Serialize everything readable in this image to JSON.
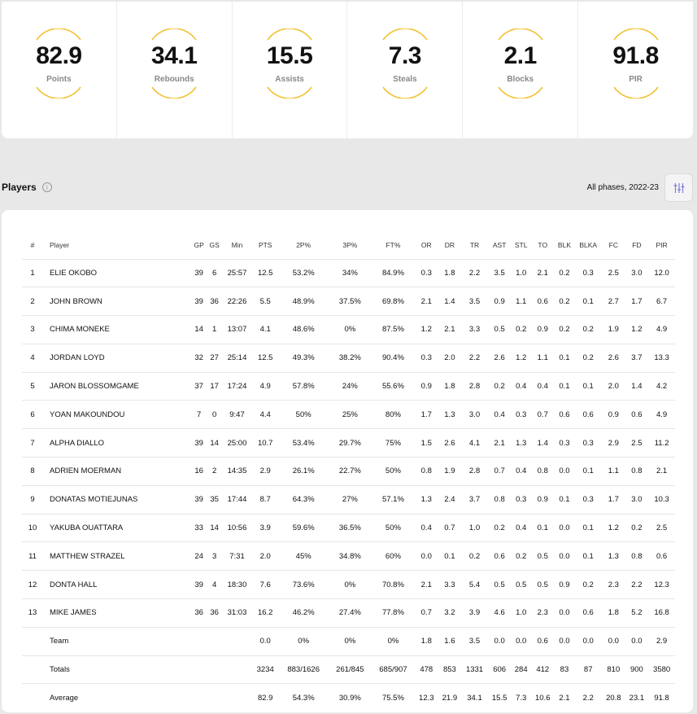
{
  "stats": [
    {
      "value": "82.9",
      "label": "Points"
    },
    {
      "value": "34.1",
      "label": "Rebounds"
    },
    {
      "value": "15.5",
      "label": "Assists"
    },
    {
      "value": "7.3",
      "label": "Steals"
    },
    {
      "value": "2.1",
      "label": "Blocks"
    },
    {
      "value": "91.8",
      "label": "PIR"
    }
  ],
  "players_section": {
    "title": "Players",
    "info_icon": "info-icon",
    "phase_filter": "All phases, 2022-23",
    "filter_icon": "sliders-icon"
  },
  "accent_color": "#f2c230",
  "table": {
    "headers": [
      "#",
      "Player",
      "GP",
      "GS",
      "Min",
      "PTS",
      "2P%",
      "3P%",
      "FT%",
      "OR",
      "DR",
      "TR",
      "AST",
      "STL",
      "TO",
      "BLK",
      "BLKA",
      "FC",
      "FD",
      "PIR"
    ],
    "rows": [
      [
        "1",
        "ELIE OKOBO",
        "39",
        "6",
        "25:57",
        "12.5",
        "53.2%",
        "34%",
        "84.9%",
        "0.3",
        "1.8",
        "2.2",
        "3.5",
        "1.0",
        "2.1",
        "0.2",
        "0.3",
        "2.5",
        "3.0",
        "12.0"
      ],
      [
        "2",
        "JOHN BROWN",
        "39",
        "36",
        "22:26",
        "5.5",
        "48.9%",
        "37.5%",
        "69.8%",
        "2.1",
        "1.4",
        "3.5",
        "0.9",
        "1.1",
        "0.6",
        "0.2",
        "0.1",
        "2.7",
        "1.7",
        "6.7"
      ],
      [
        "3",
        "CHIMA MONEKE",
        "14",
        "1",
        "13:07",
        "4.1",
        "48.6%",
        "0%",
        "87.5%",
        "1.2",
        "2.1",
        "3.3",
        "0.5",
        "0.2",
        "0.9",
        "0.2",
        "0.2",
        "1.9",
        "1.2",
        "4.9"
      ],
      [
        "4",
        "JORDAN LOYD",
        "32",
        "27",
        "25:14",
        "12.5",
        "49.3%",
        "38.2%",
        "90.4%",
        "0.3",
        "2.0",
        "2.2",
        "2.6",
        "1.2",
        "1.1",
        "0.1",
        "0.2",
        "2.6",
        "3.7",
        "13.3"
      ],
      [
        "5",
        "JARON BLOSSOMGAME",
        "37",
        "17",
        "17:24",
        "4.9",
        "57.8%",
        "24%",
        "55.6%",
        "0.9",
        "1.8",
        "2.8",
        "0.2",
        "0.4",
        "0.4",
        "0.1",
        "0.1",
        "2.0",
        "1.4",
        "4.2"
      ],
      [
        "6",
        "YOAN MAKOUNDOU",
        "7",
        "0",
        "9:47",
        "4.4",
        "50%",
        "25%",
        "80%",
        "1.7",
        "1.3",
        "3.0",
        "0.4",
        "0.3",
        "0.7",
        "0.6",
        "0.6",
        "0.9",
        "0.6",
        "4.9"
      ],
      [
        "7",
        "ALPHA DIALLO",
        "39",
        "14",
        "25:00",
        "10.7",
        "53.4%",
        "29.7%",
        "75%",
        "1.5",
        "2.6",
        "4.1",
        "2.1",
        "1.3",
        "1.4",
        "0.3",
        "0.3",
        "2.9",
        "2.5",
        "11.2"
      ],
      [
        "8",
        "ADRIEN MOERMAN",
        "16",
        "2",
        "14:35",
        "2.9",
        "26.1%",
        "22.7%",
        "50%",
        "0.8",
        "1.9",
        "2.8",
        "0.7",
        "0.4",
        "0.8",
        "0.0",
        "0.1",
        "1.1",
        "0.8",
        "2.1"
      ],
      [
        "9",
        "DONATAS MOTIEJUNAS",
        "39",
        "35",
        "17:44",
        "8.7",
        "64.3%",
        "27%",
        "57.1%",
        "1.3",
        "2.4",
        "3.7",
        "0.8",
        "0.3",
        "0.9",
        "0.1",
        "0.3",
        "1.7",
        "3.0",
        "10.3"
      ],
      [
        "10",
        "YAKUBA OUATTARA",
        "33",
        "14",
        "10:56",
        "3.9",
        "59.6%",
        "36.5%",
        "50%",
        "0.4",
        "0.7",
        "1.0",
        "0.2",
        "0.4",
        "0.1",
        "0.0",
        "0.1",
        "1.2",
        "0.2",
        "2.5"
      ],
      [
        "11",
        "MATTHEW STRAZEL",
        "24",
        "3",
        "7:31",
        "2.0",
        "45%",
        "34.8%",
        "60%",
        "0.0",
        "0.1",
        "0.2",
        "0.6",
        "0.2",
        "0.5",
        "0.0",
        "0.1",
        "1.3",
        "0.8",
        "0.6"
      ],
      [
        "12",
        "DONTA HALL",
        "39",
        "4",
        "18:30",
        "7.6",
        "73.6%",
        "0%",
        "70.8%",
        "2.1",
        "3.3",
        "5.4",
        "0.5",
        "0.5",
        "0.5",
        "0.9",
        "0.2",
        "2.3",
        "2.2",
        "12.3"
      ],
      [
        "13",
        "MIKE JAMES",
        "36",
        "36",
        "31:03",
        "16.2",
        "46.2%",
        "27.4%",
        "77.8%",
        "0.7",
        "3.2",
        "3.9",
        "4.6",
        "1.0",
        "2.3",
        "0.0",
        "0.6",
        "1.8",
        "5.2",
        "16.8"
      ]
    ],
    "summary_rows": [
      [
        "",
        "Team",
        "",
        "",
        "",
        "0.0",
        "0%",
        "0%",
        "0%",
        "1.8",
        "1.6",
        "3.5",
        "0.0",
        "0.0",
        "0.6",
        "0.0",
        "0.0",
        "0.0",
        "0.0",
        "2.9"
      ],
      [
        "",
        "Totals",
        "",
        "",
        "",
        "3234",
        "883/1626",
        "261/845",
        "685/907",
        "478",
        "853",
        "1331",
        "606",
        "284",
        "412",
        "83",
        "87",
        "810",
        "900",
        "3580"
      ],
      [
        "",
        "Average",
        "",
        "",
        "",
        "82.9",
        "54.3%",
        "30.9%",
        "75.5%",
        "12.3",
        "21.9",
        "34.1",
        "15.5",
        "7.3",
        "10.6",
        "2.1",
        "2.2",
        "20.8",
        "23.1",
        "91.8"
      ]
    ]
  }
}
